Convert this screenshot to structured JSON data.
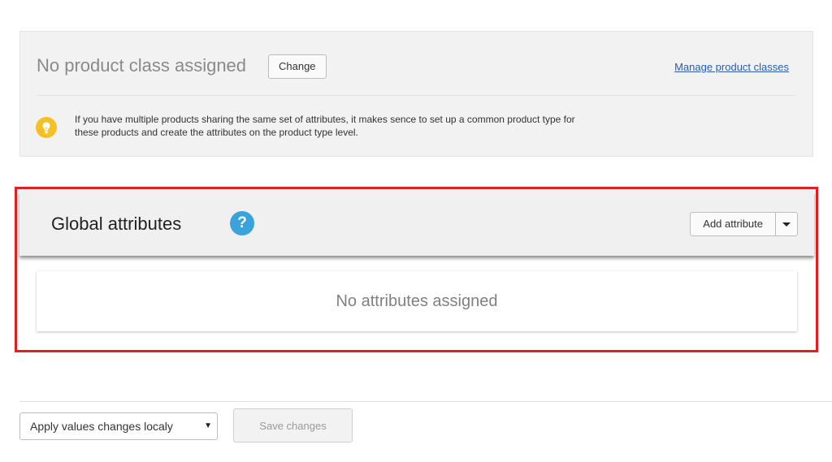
{
  "product_class": {
    "title": "No product class assigned",
    "change_label": "Change",
    "manage_link": "Manage product classes",
    "tip_text": "If you have multiple products sharing the same set of attributes, it makes sence to set up a common product type for these products and create the attributes on the product type level.",
    "tip_icon": "lightbulb-icon"
  },
  "global_attributes": {
    "title": "Global attributes",
    "help_glyph": "?",
    "add_label": "Add attribute",
    "empty_text": "No attributes assigned",
    "highlight_color": "#e41e1e"
  },
  "footer": {
    "apply_select_value": "Apply values changes localy",
    "save_label": "Save changes"
  }
}
